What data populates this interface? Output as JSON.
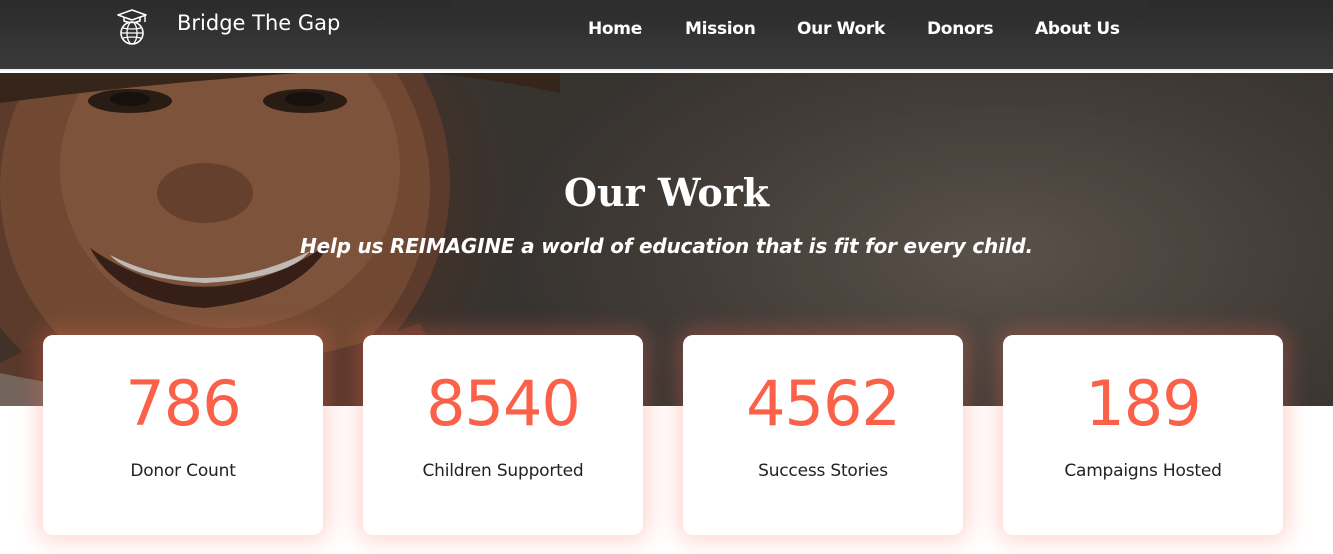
{
  "brand": {
    "name": "Bridge The Gap",
    "logo_icon": "globe-graduation-cap-icon"
  },
  "nav": {
    "links": [
      {
        "label": "Home"
      },
      {
        "label": "Mission"
      },
      {
        "label": "Our Work"
      },
      {
        "label": "Donors"
      },
      {
        "label": "About Us"
      }
    ]
  },
  "hero": {
    "title": "Our Work",
    "subtitle": "Help us REIMAGINE a world of education that is fit for every child."
  },
  "stats": [
    {
      "value": "786",
      "label": "Donor Count"
    },
    {
      "value": "8540",
      "label": "Children Supported"
    },
    {
      "value": "4562",
      "label": "Success Stories"
    },
    {
      "value": "189",
      "label": "Campaigns Hosted"
    }
  ],
  "colors": {
    "accent": "#fb6049",
    "navbar": "#333333",
    "text_dark": "#222222"
  }
}
